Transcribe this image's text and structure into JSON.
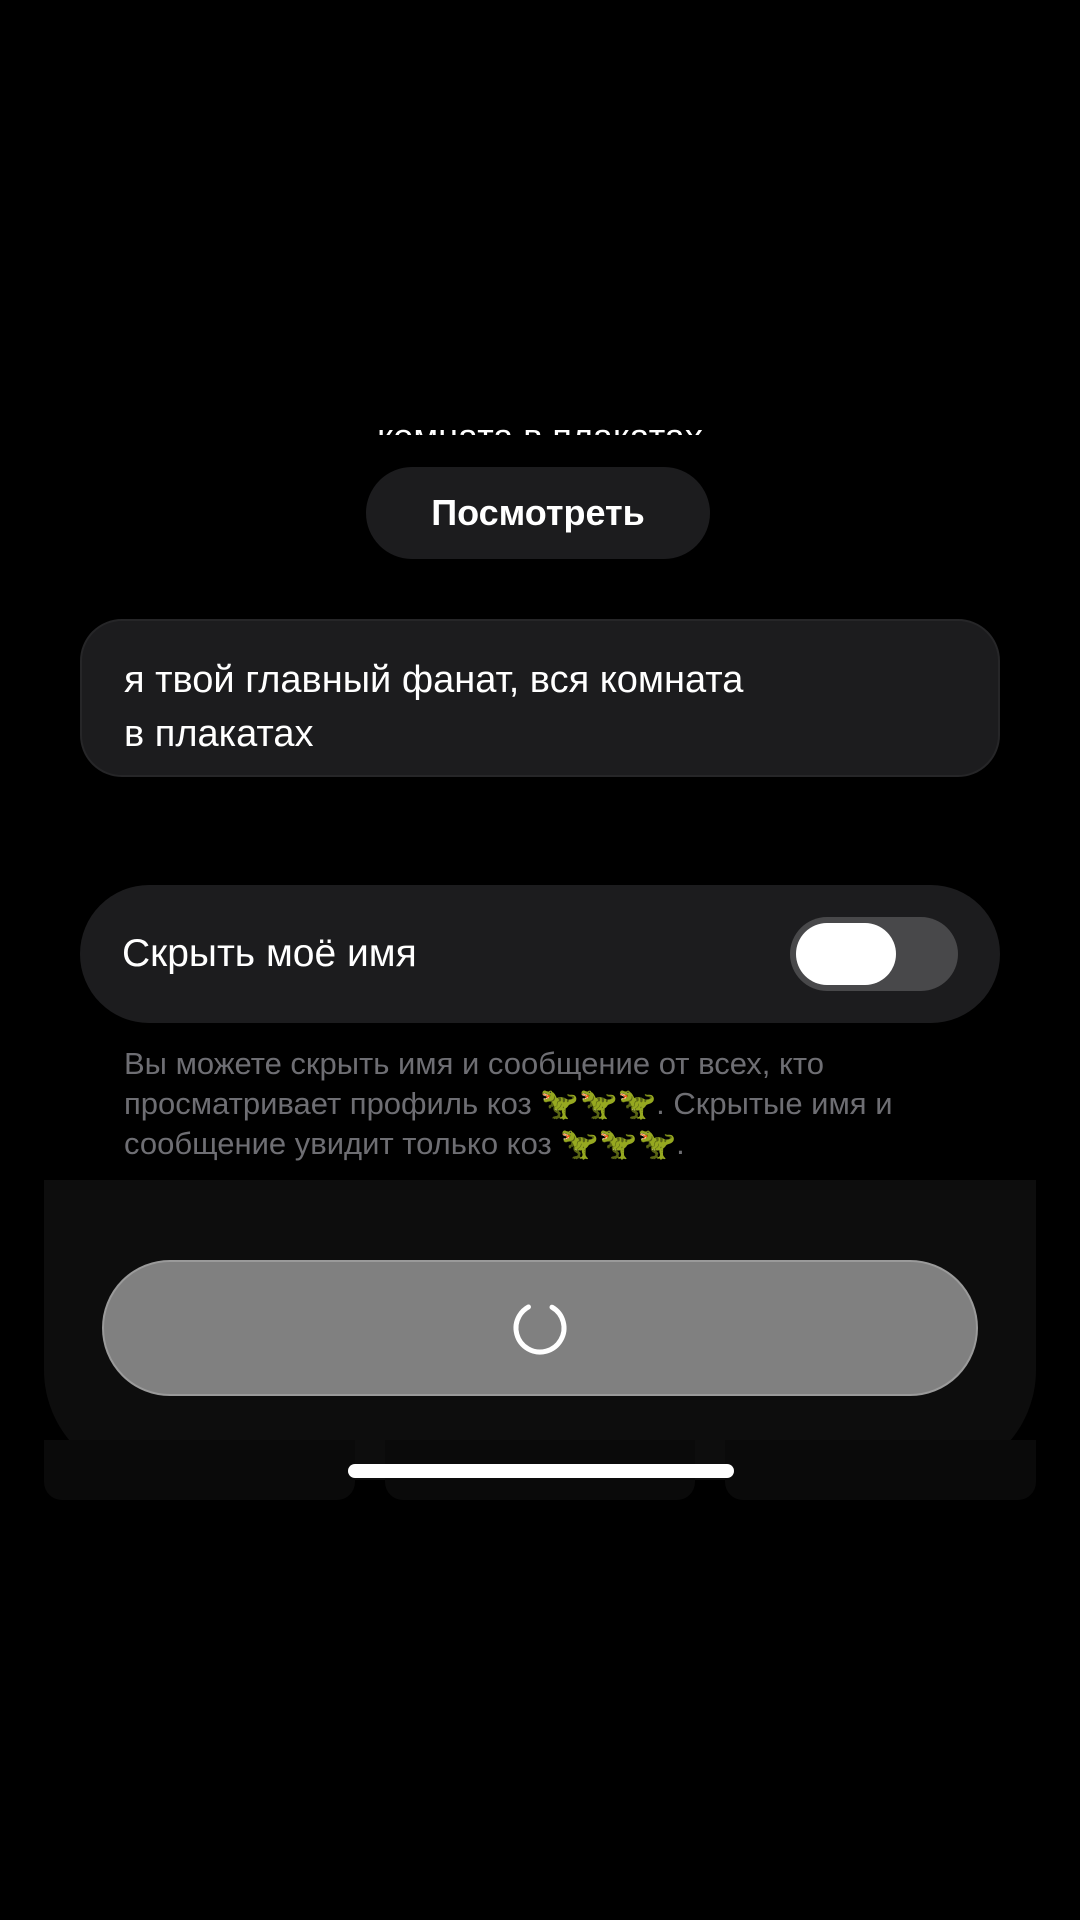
{
  "header": {
    "cutoff_text": "комната в плакатах"
  },
  "view_button": {
    "label": "Посмотреть"
  },
  "message": {
    "text": "я твой главный фанат, вся комната в плакатах"
  },
  "hide_name": {
    "label": "Скрыть моё имя",
    "enabled": true
  },
  "helper": {
    "text": "Вы можете скрыть имя и сообщение от всех, кто просматривает профиль коз 🦖🦖🦖. Скрытые имя и сообщение увидит только коз 🦖🦖🦖."
  },
  "submit": {
    "state": "loading"
  },
  "colors": {
    "background": "#000000",
    "surface": "#1c1c1e",
    "toggle_track": "#48484a",
    "button_disabled": "#808080",
    "helper_text": "#6e6e73"
  }
}
